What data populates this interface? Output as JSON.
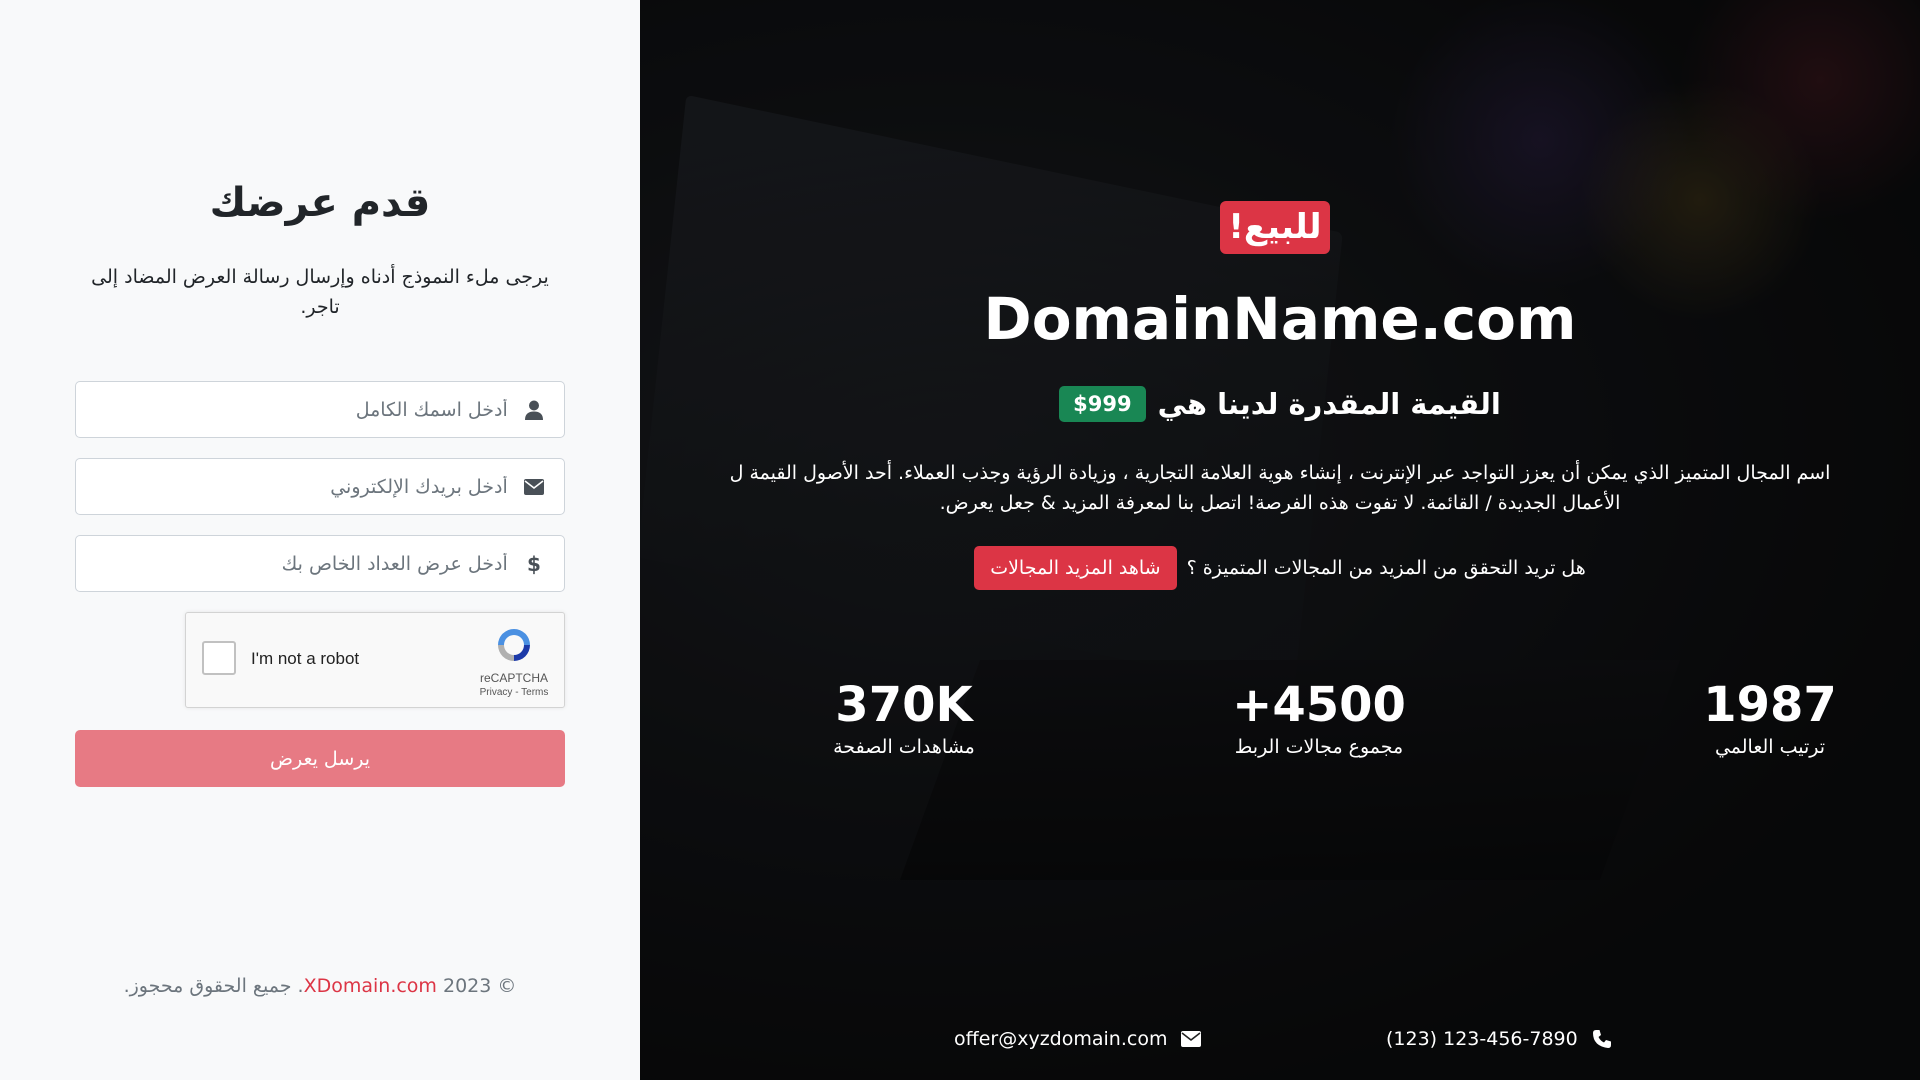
{
  "form": {
    "title": "قدم عرضك",
    "subtitle": "يرجى ملء النموذج أدناه وإرسال رسالة العرض المضاد إلى تاجر.",
    "name_placeholder": "أدخل اسمك الكامل",
    "email_placeholder": "أدخل بريدك الإلكتروني",
    "offer_placeholder": "أدخل عرض العداد الخاص بك",
    "captcha": {
      "label": "I'm not a robot",
      "brand": "reCAPTCHA",
      "links": "Privacy - Terms"
    },
    "submit_label": "يرسل يعرض"
  },
  "footer": {
    "prefix": "© 2023",
    "brand": "XDomain.com",
    "suffix": ". جميع الحقوق محجوز."
  },
  "hero": {
    "badge": "للبيع!",
    "domain": "DomainName.com",
    "value_text": "القيمة المقدرة لدينا هي",
    "price": "$999",
    "description": "اسم المجال المتميز الذي يمكن أن يعزز التواجد عبر الإنترنت ، إنشاء هوية العلامة التجارية ، وزيادة الرؤية وجذب العملاء. أحد الأصول القيمة ل الأعمال الجديدة / القائمة. لا تفوت هذه الفرصة! اتصل بنا لمعرفة المزيد & جعل يعرض.",
    "more_question": "هل تريد التحقق من المزيد من المجالات المتميزة ؟",
    "more_button": "شاهد المزيد المجالات"
  },
  "stats": [
    {
      "value": "1987",
      "label": "ترتيب العالمي"
    },
    {
      "value": "+4500",
      "label": "مجموع مجالات الربط"
    },
    {
      "value": "370K",
      "label": "مشاهدات الصفحة"
    }
  ],
  "contact": {
    "phone": "(123) 123-456-7890",
    "email": "offer@xyzdomain.com"
  },
  "colors": {
    "accent": "#dc3545",
    "price_badge": "#198754",
    "submit": "#e77a84"
  }
}
